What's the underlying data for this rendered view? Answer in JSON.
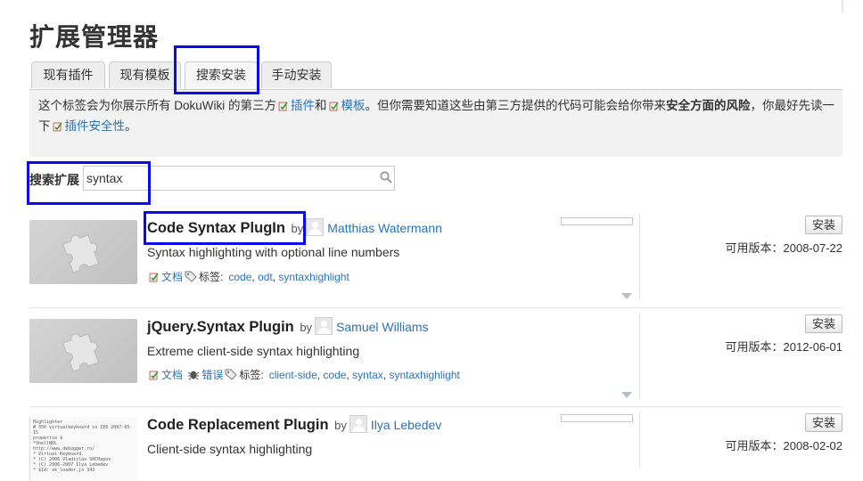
{
  "page": {
    "title": "扩展管理器"
  },
  "tabs": [
    {
      "label": "现有插件"
    },
    {
      "label": "现有模板"
    },
    {
      "label": "搜索安装"
    },
    {
      "label": "手动安装"
    }
  ],
  "info": {
    "part1": "这个标签会为你展示所有 DokuWiki 的第三方",
    "plugins_link": "插件",
    "and": "和",
    "templates_link": "模板",
    "part2": "。但你需要知道这些由第三方提供的代码可能会给你带来",
    "bold": "安全方面的风险",
    "part3": "，你最好先读一下",
    "security_link": "插件安全性",
    "period": "。"
  },
  "search": {
    "label": "搜索扩展",
    "value": "syntax"
  },
  "extensions": [
    {
      "title": "Code Syntax PlugIn",
      "by": "by",
      "author": "Matthias Watermann",
      "description": "Syntax highlighting with optional line numbers",
      "docs": "文档",
      "bugs": "",
      "tags_label": "标签:",
      "tags": [
        "code",
        "odt",
        "syntaxhighlight"
      ],
      "install": "安装",
      "version_label": "可用版本：",
      "version": "2008-07-22"
    },
    {
      "title": "jQuery.Syntax Plugin",
      "by": "by",
      "author": "Samuel Williams",
      "description": "Extreme client-side syntax highlighting",
      "docs": "文档",
      "bugs": "错误",
      "tags_label": "标签:",
      "tags": [
        "client-side",
        "code",
        "syntax",
        "syntaxhighlight"
      ],
      "install": "安装",
      "version_label": "可用版本：",
      "version": "2012-06-01"
    },
    {
      "title": "Code Replacement Plugin",
      "by": "by",
      "author": "Ilya Lebedev",
      "description": "Client-side syntax highlighting",
      "install": "安装",
      "version_label": "可用版本：",
      "version": "2008-02-02",
      "screenshot_lines": [
        "Highlighter",
        "# 356 virtualkeyboard in IE6 2007-05-15",
        "propertie $",
        "*ShellNDL",
        "http://www.debugger.ru/",
        "",
        "* Virtual Keyboard.",
        "* (C) 2006 Vladislav SHCHapov",
        "* (C) 2006-2007 Ilya Lebedev",
        "* $Id: vk_loader.js 343"
      ]
    }
  ],
  "colors": {
    "link": "#2b73b7",
    "highlight_box": "#0a0aee",
    "panel_bg": "#f2f2f2"
  }
}
